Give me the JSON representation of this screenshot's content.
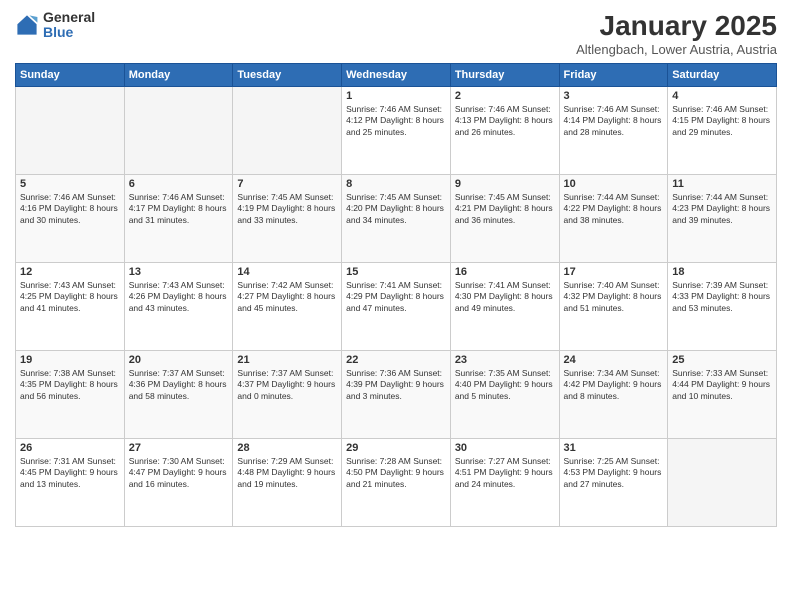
{
  "logo": {
    "general": "General",
    "blue": "Blue"
  },
  "header": {
    "title": "January 2025",
    "subtitle": "Altlengbach, Lower Austria, Austria"
  },
  "weekdays": [
    "Sunday",
    "Monday",
    "Tuesday",
    "Wednesday",
    "Thursday",
    "Friday",
    "Saturday"
  ],
  "weeks": [
    [
      {
        "day": "",
        "info": ""
      },
      {
        "day": "",
        "info": ""
      },
      {
        "day": "",
        "info": ""
      },
      {
        "day": "1",
        "info": "Sunrise: 7:46 AM\nSunset: 4:12 PM\nDaylight: 8 hours\nand 25 minutes."
      },
      {
        "day": "2",
        "info": "Sunrise: 7:46 AM\nSunset: 4:13 PM\nDaylight: 8 hours\nand 26 minutes."
      },
      {
        "day": "3",
        "info": "Sunrise: 7:46 AM\nSunset: 4:14 PM\nDaylight: 8 hours\nand 28 minutes."
      },
      {
        "day": "4",
        "info": "Sunrise: 7:46 AM\nSunset: 4:15 PM\nDaylight: 8 hours\nand 29 minutes."
      }
    ],
    [
      {
        "day": "5",
        "info": "Sunrise: 7:46 AM\nSunset: 4:16 PM\nDaylight: 8 hours\nand 30 minutes."
      },
      {
        "day": "6",
        "info": "Sunrise: 7:46 AM\nSunset: 4:17 PM\nDaylight: 8 hours\nand 31 minutes."
      },
      {
        "day": "7",
        "info": "Sunrise: 7:45 AM\nSunset: 4:19 PM\nDaylight: 8 hours\nand 33 minutes."
      },
      {
        "day": "8",
        "info": "Sunrise: 7:45 AM\nSunset: 4:20 PM\nDaylight: 8 hours\nand 34 minutes."
      },
      {
        "day": "9",
        "info": "Sunrise: 7:45 AM\nSunset: 4:21 PM\nDaylight: 8 hours\nand 36 minutes."
      },
      {
        "day": "10",
        "info": "Sunrise: 7:44 AM\nSunset: 4:22 PM\nDaylight: 8 hours\nand 38 minutes."
      },
      {
        "day": "11",
        "info": "Sunrise: 7:44 AM\nSunset: 4:23 PM\nDaylight: 8 hours\nand 39 minutes."
      }
    ],
    [
      {
        "day": "12",
        "info": "Sunrise: 7:43 AM\nSunset: 4:25 PM\nDaylight: 8 hours\nand 41 minutes."
      },
      {
        "day": "13",
        "info": "Sunrise: 7:43 AM\nSunset: 4:26 PM\nDaylight: 8 hours\nand 43 minutes."
      },
      {
        "day": "14",
        "info": "Sunrise: 7:42 AM\nSunset: 4:27 PM\nDaylight: 8 hours\nand 45 minutes."
      },
      {
        "day": "15",
        "info": "Sunrise: 7:41 AM\nSunset: 4:29 PM\nDaylight: 8 hours\nand 47 minutes."
      },
      {
        "day": "16",
        "info": "Sunrise: 7:41 AM\nSunset: 4:30 PM\nDaylight: 8 hours\nand 49 minutes."
      },
      {
        "day": "17",
        "info": "Sunrise: 7:40 AM\nSunset: 4:32 PM\nDaylight: 8 hours\nand 51 minutes."
      },
      {
        "day": "18",
        "info": "Sunrise: 7:39 AM\nSunset: 4:33 PM\nDaylight: 8 hours\nand 53 minutes."
      }
    ],
    [
      {
        "day": "19",
        "info": "Sunrise: 7:38 AM\nSunset: 4:35 PM\nDaylight: 8 hours\nand 56 minutes."
      },
      {
        "day": "20",
        "info": "Sunrise: 7:37 AM\nSunset: 4:36 PM\nDaylight: 8 hours\nand 58 minutes."
      },
      {
        "day": "21",
        "info": "Sunrise: 7:37 AM\nSunset: 4:37 PM\nDaylight: 9 hours\nand 0 minutes."
      },
      {
        "day": "22",
        "info": "Sunrise: 7:36 AM\nSunset: 4:39 PM\nDaylight: 9 hours\nand 3 minutes."
      },
      {
        "day": "23",
        "info": "Sunrise: 7:35 AM\nSunset: 4:40 PM\nDaylight: 9 hours\nand 5 minutes."
      },
      {
        "day": "24",
        "info": "Sunrise: 7:34 AM\nSunset: 4:42 PM\nDaylight: 9 hours\nand 8 minutes."
      },
      {
        "day": "25",
        "info": "Sunrise: 7:33 AM\nSunset: 4:44 PM\nDaylight: 9 hours\nand 10 minutes."
      }
    ],
    [
      {
        "day": "26",
        "info": "Sunrise: 7:31 AM\nSunset: 4:45 PM\nDaylight: 9 hours\nand 13 minutes."
      },
      {
        "day": "27",
        "info": "Sunrise: 7:30 AM\nSunset: 4:47 PM\nDaylight: 9 hours\nand 16 minutes."
      },
      {
        "day": "28",
        "info": "Sunrise: 7:29 AM\nSunset: 4:48 PM\nDaylight: 9 hours\nand 19 minutes."
      },
      {
        "day": "29",
        "info": "Sunrise: 7:28 AM\nSunset: 4:50 PM\nDaylight: 9 hours\nand 21 minutes."
      },
      {
        "day": "30",
        "info": "Sunrise: 7:27 AM\nSunset: 4:51 PM\nDaylight: 9 hours\nand 24 minutes."
      },
      {
        "day": "31",
        "info": "Sunrise: 7:25 AM\nSunset: 4:53 PM\nDaylight: 9 hours\nand 27 minutes."
      },
      {
        "day": "",
        "info": ""
      }
    ]
  ]
}
